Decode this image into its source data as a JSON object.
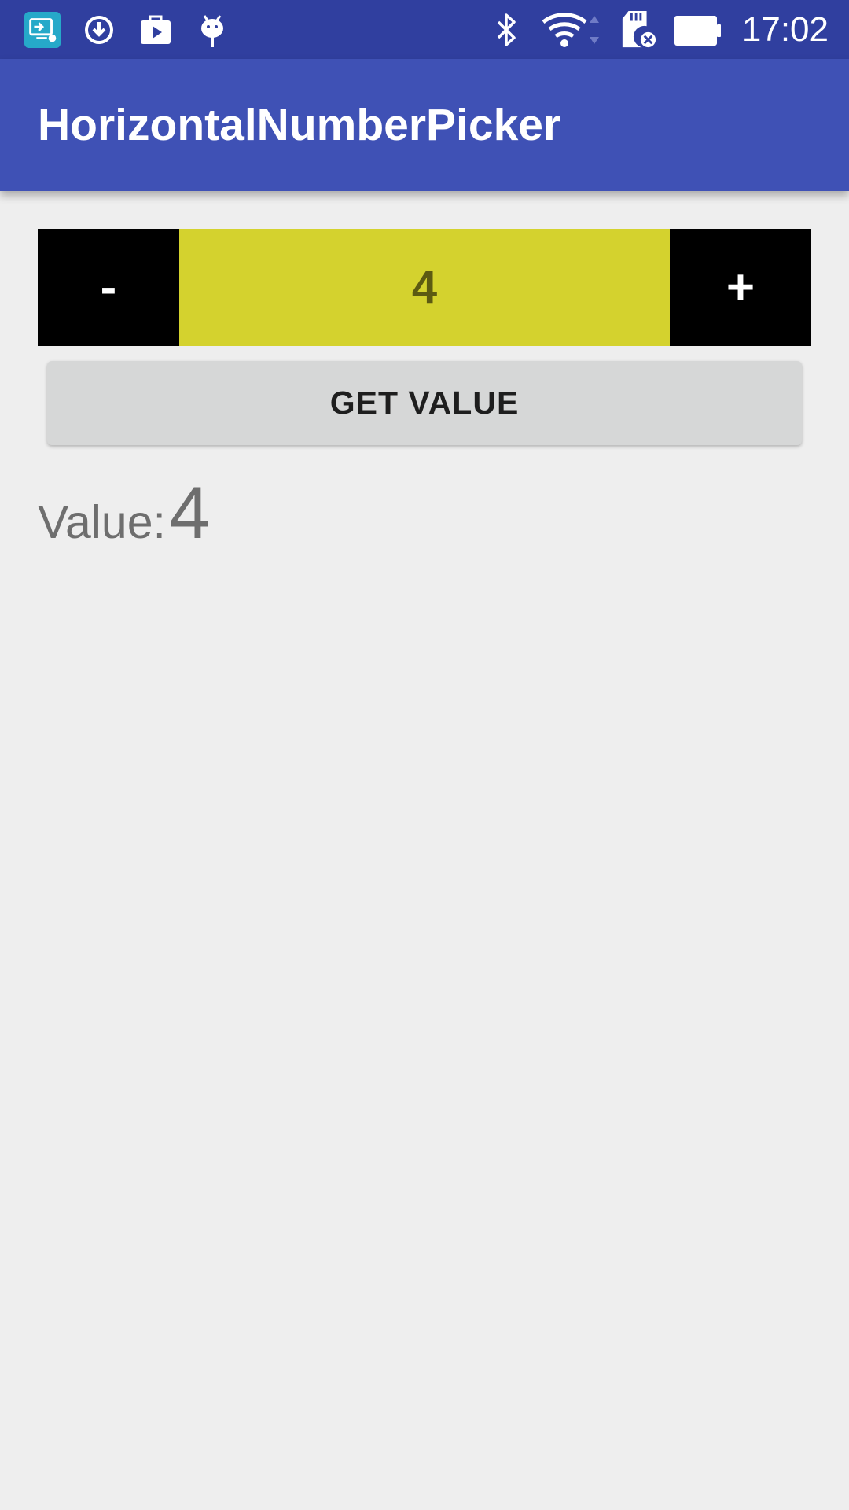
{
  "status_bar": {
    "left_icons": [
      "screen-share-icon",
      "download-sync-icon",
      "media-bag-icon",
      "android-debug-icon"
    ],
    "right_icons": [
      "bluetooth-icon",
      "wifi-icon",
      "sd-card-error-icon",
      "battery-icon"
    ],
    "time": "17:02",
    "colors": {
      "background": "#303f9f",
      "foreground": "#ffffff"
    }
  },
  "app_bar": {
    "title": "HorizontalNumberPicker",
    "colors": {
      "background": "#3f51b5",
      "foreground": "#ffffff"
    }
  },
  "picker": {
    "minus_label": "-",
    "value": "4",
    "plus_label": "+",
    "colors": {
      "buttons": "#000000",
      "button_text": "#ffffff",
      "value_bg": "#d4d22e",
      "value_text": "#5c5a12"
    }
  },
  "get_value_button": {
    "label": "GET VALUE",
    "colors": {
      "background": "#d6d7d7",
      "text": "#1e1e1e"
    }
  },
  "result": {
    "label": "Value:",
    "value": "4",
    "colors": {
      "text": "#6e6e6e"
    }
  },
  "page": {
    "colors": {
      "background": "#eeeeee"
    }
  }
}
